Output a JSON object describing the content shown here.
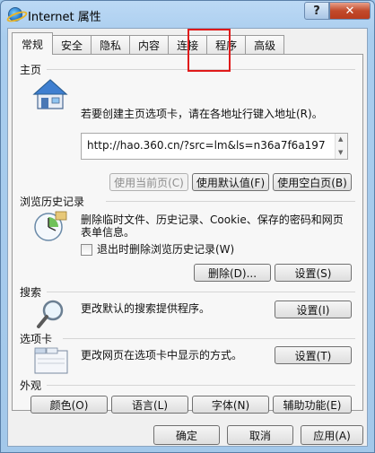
{
  "window": {
    "title": "Internet 属性",
    "help_label": "?",
    "close_label": "✕"
  },
  "tabs": [
    {
      "label": "常规"
    },
    {
      "label": "安全"
    },
    {
      "label": "隐私"
    },
    {
      "label": "内容"
    },
    {
      "label": "连接"
    },
    {
      "label": "程序"
    },
    {
      "label": "高级"
    }
  ],
  "homepage": {
    "title": "主页",
    "description": "若要创建主页选项卡，请在各地址行键入地址(R)。",
    "url": "http://hao.360.cn/?src=lm&ls=n36a7f6a197",
    "use_current": "使用当前页(C)",
    "use_default": "使用默认值(F)",
    "use_blank": "使用空白页(B)"
  },
  "history": {
    "title": "浏览历史记录",
    "description_line1": "删除临时文件、历史记录、Cookie、保存的密码和网页",
    "description_line2": "表单信息。",
    "checkbox_label": "退出时删除浏览历史记录(W)",
    "delete_button": "删除(D)...",
    "settings_button": "设置(S)"
  },
  "search": {
    "title": "搜索",
    "description": "更改默认的搜索提供程序。",
    "settings_button": "设置(I)"
  },
  "tabs_section": {
    "title": "选项卡",
    "description": "更改网页在选项卡中显示的方式。",
    "settings_button": "设置(T)"
  },
  "appearance": {
    "title": "外观",
    "colors": "颜色(O)",
    "languages": "语言(L)",
    "fonts": "字体(N)",
    "accessibility": "辅助功能(E)"
  },
  "footer": {
    "ok": "确定",
    "cancel": "取消",
    "apply": "应用(A)"
  }
}
